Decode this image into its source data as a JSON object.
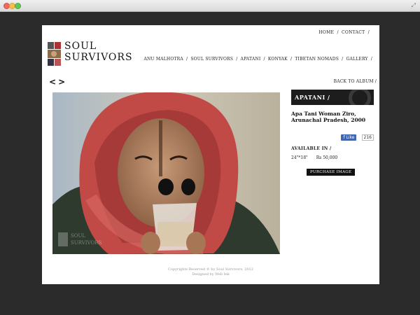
{
  "browser": {
    "expand_icon": "expand-icon"
  },
  "logo": {
    "line1": "SOUL",
    "line2": "SURVIVORS"
  },
  "top_nav": {
    "home": "HOME",
    "contact": "CONTACT",
    "sep": "/"
  },
  "main_nav": {
    "items": [
      "ANU MALHOTRA",
      "SOUL SURVIVORS",
      "APATANI",
      "KONYAK",
      "TIBETAN NOMADS",
      "GALLERY"
    ],
    "sep": "/"
  },
  "pager": {
    "prev": "<",
    "next": ">"
  },
  "back_to_album": "BACK TO ALBUM /",
  "photo": {
    "watermark_line1": "SOUL",
    "watermark_line2": "SURVIVORS"
  },
  "sidebar": {
    "category": "APATANI /",
    "title": "Apa Tani Woman Ziro, Arunachal Pradesh, 2000",
    "like_label": "Like",
    "like_count": "216",
    "available_label": "AVAILABLE IN /",
    "size": "24\"*18\"",
    "price": "Rs 50,000",
    "purchase_label": "PURCHASE IMAGE"
  },
  "footer": {
    "line1": "Copyrights Reserved © by Soul Survivors, 2012",
    "line2": "Designed by Web Ink"
  },
  "colors": {
    "background": "#2b2b2b",
    "page": "#ffffff",
    "dark_bar": "#1d1d1d",
    "facebook": "#4267b2"
  }
}
